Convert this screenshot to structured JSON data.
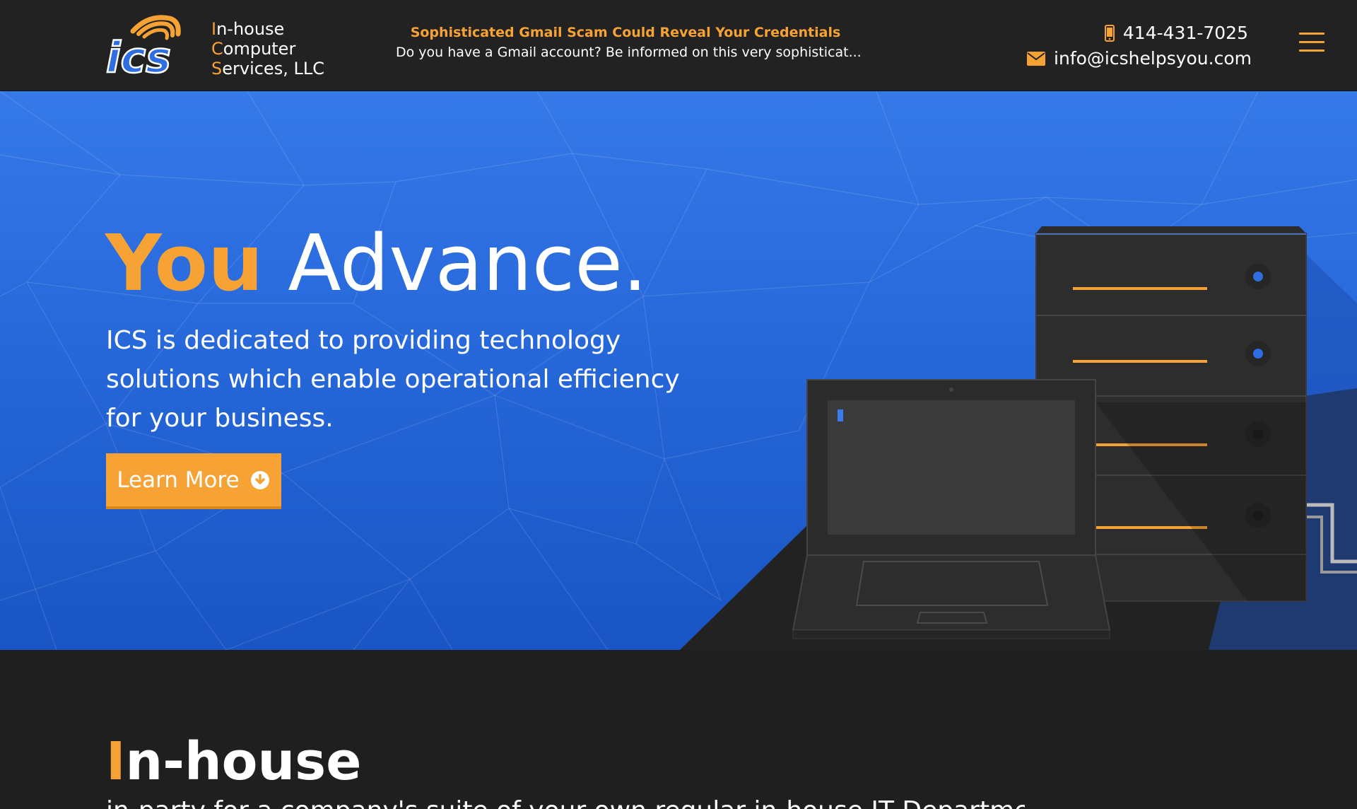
{
  "header": {
    "logo_text": "ICS",
    "company_lines": [
      {
        "initial": "I",
        "rest": "n-house"
      },
      {
        "initial": "C",
        "rest": "omputer"
      },
      {
        "initial": "S",
        "rest": "ervices, LLC"
      }
    ],
    "news_title": "Sophisticated Gmail Scam Could Reveal Your Credentials",
    "news_excerpt": "Do you have a Gmail account? Be informed on this very sophisticat...",
    "phone": "414-431-7025",
    "email": "info@icshelpsyou.com",
    "menu_icon": "hamburger-icon"
  },
  "hero": {
    "title_highlight": "You",
    "title_rest": " Advance.",
    "description": "ICS is dedicated to providing technology solutions which enable operational efficiency for your business.",
    "cta_label": "Learn More",
    "cta_icon": "arrow-down-circle-icon"
  },
  "section": {
    "title_initial": "I",
    "title_rest": "n-house",
    "text_partial": "in-party for a company's suite of your own regular in-house IT Department"
  },
  "colors": {
    "accent": "#f7a234",
    "hero_blue": "#2a6ee0",
    "dark": "#222222"
  }
}
